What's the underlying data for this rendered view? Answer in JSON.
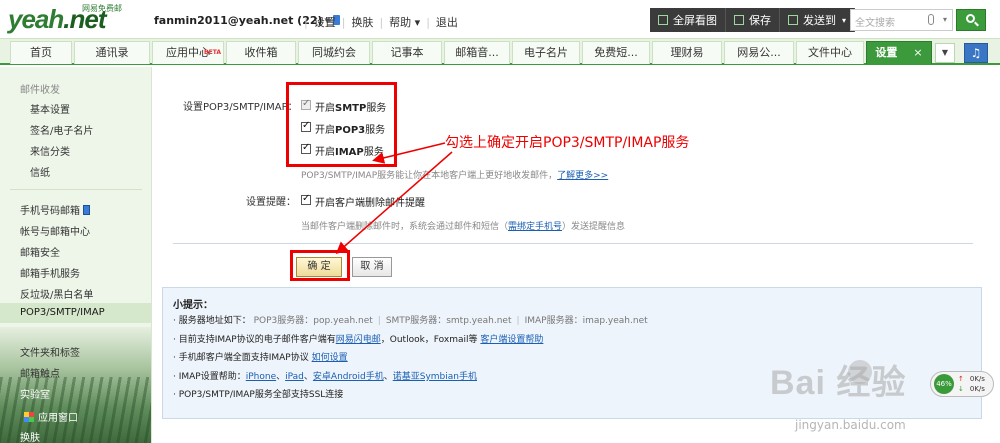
{
  "brand": {
    "logo_main": "yeah",
    "logo_tld": ".net",
    "logo_tagline": "网易免费邮"
  },
  "header": {
    "account": "fanmin2011@yeah.net (22)",
    "links": [
      "设置",
      "换肤",
      "帮助",
      "退出"
    ],
    "buttons": [
      "全屏看图",
      "保存",
      "发送到"
    ],
    "search_placeholder": "全文搜索"
  },
  "tabs": [
    {
      "label": "首页"
    },
    {
      "label": "通讯录"
    },
    {
      "label": "应用中心",
      "badge": "BETA"
    },
    {
      "label": "收件箱"
    },
    {
      "label": "同城约会"
    },
    {
      "label": "记事本"
    },
    {
      "label": "邮箱音..."
    },
    {
      "label": "电子名片"
    },
    {
      "label": "免费短..."
    },
    {
      "label": "理财易"
    },
    {
      "label": "网易公..."
    },
    {
      "label": "文件中心"
    },
    {
      "label": "设置",
      "close": "×"
    }
  ],
  "sidebar": {
    "group": "邮件收发",
    "items": [
      "基本设置",
      "签名/电子名片",
      "来信分类",
      "信纸",
      "手机号码邮箱",
      "帐号与邮箱中心",
      "邮箱安全",
      "邮箱手机服务",
      "反垃圾/黑白名单",
      "POP3/SMTP/IMAP",
      "文件夹和标签",
      "邮箱触点",
      "实验室",
      "换肤"
    ],
    "app_window": "应用窗口"
  },
  "main": {
    "setting_label": "设置POP3/SMTP/IMAP：",
    "options": [
      {
        "pre": "开启",
        "strong": "SMTP",
        "post": "服务",
        "checked": true,
        "disabled": true
      },
      {
        "pre": "开启",
        "strong": "POP3",
        "post": "服务",
        "checked": true,
        "disabled": false
      },
      {
        "pre": "开启",
        "strong": "IMAP",
        "post": "服务",
        "checked": true,
        "disabled": false
      }
    ],
    "pop_hint": "POP3/SMTP/IMAP服务能让你在本地客户端上更好地收发邮件，",
    "pop_hint_link": "了解更多>>",
    "remind_label": "设置提醒：",
    "remind_option": "开启客户端删除邮件提醒",
    "remind_hint_pre": "当邮件客户端删除邮件时，系统会通过邮件和短信（",
    "remind_hint_link": "需绑定手机号",
    "remind_hint_post": "）发送提醒信息",
    "ok_button": "确 定",
    "cancel_button": "取 消",
    "annotation": "勾选上确定开启POP3/SMTP/IMAP服务"
  },
  "tips": {
    "title": "小提示：",
    "server_label": "· 服务器地址如下：",
    "servers": [
      "POP3服务器：pop.yeah.net",
      "SMTP服务器：smtp.yeah.net",
      "IMAP服务器：imap.yeah.net"
    ],
    "line2_pre": "· 目前支持IMAP协议的电子邮件客户端有",
    "line2_link1": "网易闪电邮",
    "line2_mid": "，Outlook，Foxmail等",
    "line2_link2": "客户端设置帮助",
    "line3_pre": "· 手机邮客户端全面支持IMAP协议",
    "line3_link": "如何设置",
    "line4_pre": "· IMAP设置帮助：",
    "line4_links": [
      "iPhone",
      "iPad",
      "安卓Android手机",
      "诺基亚Symbian手机"
    ],
    "line5": "· POP3/SMTP/IMAP服务全部支持SSL连接"
  },
  "watermark": {
    "main": "Bai 经验",
    "sub": "jingyan.baidu.com"
  },
  "net_widget": {
    "percent": "46%",
    "up": "0K/s",
    "down": "0K/s"
  },
  "colors": {
    "brand_green": "#3c9a3c",
    "annotation_red": "#e00000",
    "link_blue": "#1a5fb4"
  }
}
